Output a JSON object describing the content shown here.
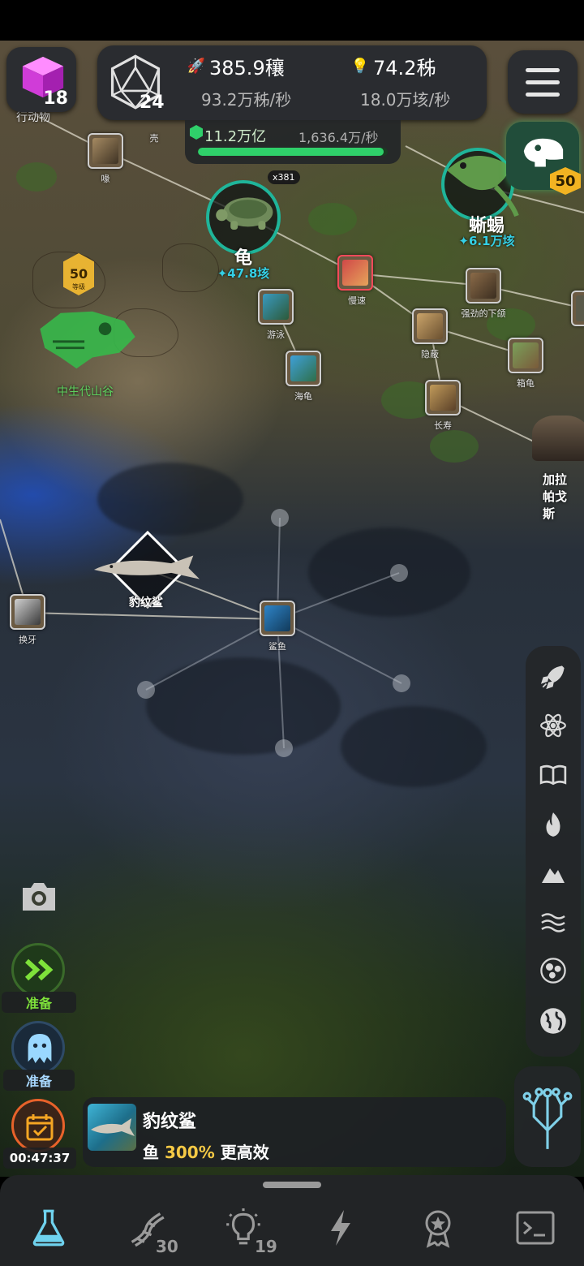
{
  "hud": {
    "cube_count": "18",
    "d20_count": "24",
    "resource_a": {
      "value": "385.9穰",
      "rate": "93.2万秭/秒",
      "icon": "rocket-icon"
    },
    "resource_b": {
      "value": "74.2秭",
      "rate": "18.0万垓/秒",
      "icon": "lightbulb-icon"
    },
    "dna": {
      "value": "11.2万亿",
      "rate": "1,636.4万/秒",
      "progress": 0.98
    },
    "dino_level": "50"
  },
  "map": {
    "top_left_label": "行动物",
    "top_partial_label": "壳",
    "valley": {
      "level": "50",
      "level_tag": "等级",
      "name": "中生代山谷"
    },
    "turtle": {
      "name": "龟",
      "value": "47.8垓",
      "count": "x381"
    },
    "lizard": {
      "name": "蜥蜴",
      "value": "6.1万垓"
    },
    "galapagos": {
      "name": "加拉帕戈斯"
    },
    "shark_hero": {
      "name": "豹纹鲨"
    },
    "nodes": [
      {
        "id": "beak",
        "label": "喙"
      },
      {
        "id": "swim",
        "label": "游泳"
      },
      {
        "id": "sea-turtle",
        "label": "海龟"
      },
      {
        "id": "slow",
        "label": "慢速"
      },
      {
        "id": "strong-jaw",
        "label": "强劲的下颌"
      },
      {
        "id": "hide",
        "label": "隐蔽"
      },
      {
        "id": "box-turtle",
        "label": "箱龟"
      },
      {
        "id": "longevity",
        "label": "长寿"
      },
      {
        "id": "tooth-replace",
        "label": "换牙"
      },
      {
        "id": "shark",
        "label": "鲨鱼"
      }
    ]
  },
  "side_tools": [
    "rocket-icon",
    "atom-icon",
    "book-icon",
    "fire-icon",
    "mountain-icon",
    "waves-icon",
    "cell-icon",
    "globe-icon"
  ],
  "controls": {
    "fast_forward_label": "准备",
    "ghost_label": "准备",
    "timer": "00:47:37"
  },
  "notice": {
    "title": "豹纹鲨",
    "body_prefix": "鱼",
    "body_highlight": "300%",
    "body_suffix": "更高效"
  },
  "bottom_nav": {
    "tabs": [
      {
        "name": "research",
        "icon": "flask-icon",
        "count": ""
      },
      {
        "name": "dna",
        "icon": "dna-icon",
        "count": "30"
      },
      {
        "name": "ideas",
        "icon": "lightbulb-icon",
        "count": "19"
      },
      {
        "name": "power",
        "icon": "lightning-icon",
        "count": ""
      },
      {
        "name": "achievements",
        "icon": "medal-icon",
        "count": ""
      },
      {
        "name": "console",
        "icon": "terminal-icon",
        "count": ""
      }
    ]
  },
  "colors": {
    "accent_green": "#2fd06a",
    "teal_ring": "#1fb59a",
    "highlight_yellow": "#f5c945",
    "value_cyan": "#34d0e6"
  }
}
